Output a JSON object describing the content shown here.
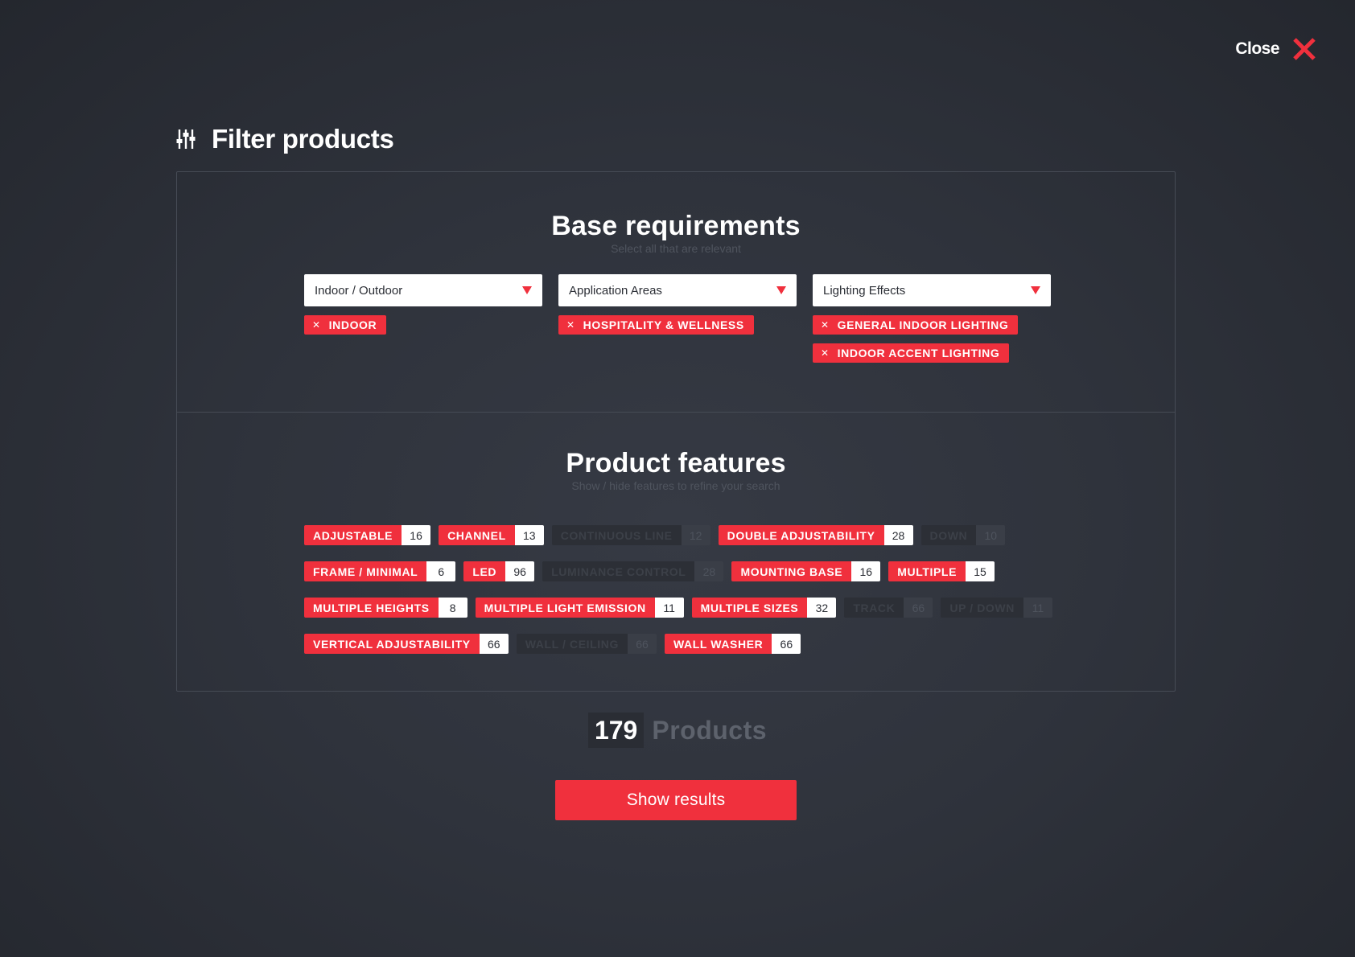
{
  "close": {
    "label": "Close",
    "icon": "close-icon"
  },
  "header": {
    "title": "Filter products",
    "icon": "sliders-icon"
  },
  "base": {
    "title": "Base requirements",
    "subtitle": "Select all that are relevant",
    "selects": [
      {
        "label": "Indoor / Outdoor",
        "chips": [
          "INDOOR"
        ]
      },
      {
        "label": "Application Areas",
        "chips": [
          "HOSPITALITY & WELLNESS"
        ]
      },
      {
        "label": "Lighting Effects",
        "chips": [
          "GENERAL INDOOR LIGHTING",
          "INDOOR ACCENT LIGHTING"
        ]
      }
    ]
  },
  "features": {
    "title": "Product features",
    "subtitle": "Show / hide features to refine your search",
    "rows": [
      [
        {
          "label": "ADJUSTABLE",
          "count": "16",
          "active": true
        },
        {
          "label": "CHANNEL",
          "count": "13",
          "active": true
        },
        {
          "label": "CONTINUOUS LINE",
          "count": "12",
          "active": false
        },
        {
          "label": "DOUBLE ADJUSTABILITY",
          "count": "28",
          "active": true
        },
        {
          "label": "DOWN",
          "count": "10",
          "active": false
        }
      ],
      [
        {
          "label": "FRAME / MINIMAL",
          "count": "6",
          "active": true
        },
        {
          "label": "LED",
          "count": "96",
          "active": true
        },
        {
          "label": "LUMINANCE CONTROL",
          "count": "28",
          "active": false
        },
        {
          "label": "MOUNTING BASE",
          "count": "16",
          "active": true
        },
        {
          "label": "MULTIPLE",
          "count": "15",
          "active": true
        }
      ],
      [
        {
          "label": "MULTIPLE HEIGHTS",
          "count": "8",
          "active": true
        },
        {
          "label": "MULTIPLE LIGHT EMISSION",
          "count": "11",
          "active": true
        },
        {
          "label": "MULTIPLE SIZES",
          "count": "32",
          "active": true
        },
        {
          "label": "TRACK",
          "count": "66",
          "active": false
        },
        {
          "label": "UP / DOWN",
          "count": "11",
          "active": false
        }
      ],
      [
        {
          "label": "VERTICAL ADJUSTABILITY",
          "count": "66",
          "active": true
        },
        {
          "label": "WALL / CEILING",
          "count": "66",
          "active": false
        },
        {
          "label": "WALL WASHER",
          "count": "66",
          "active": true
        }
      ]
    ]
  },
  "results": {
    "count": "179",
    "label": "Products",
    "button": "Show results"
  },
  "colors": {
    "accent": "#f0303d",
    "background": "#2f333c",
    "panel_border": "#464b55"
  }
}
